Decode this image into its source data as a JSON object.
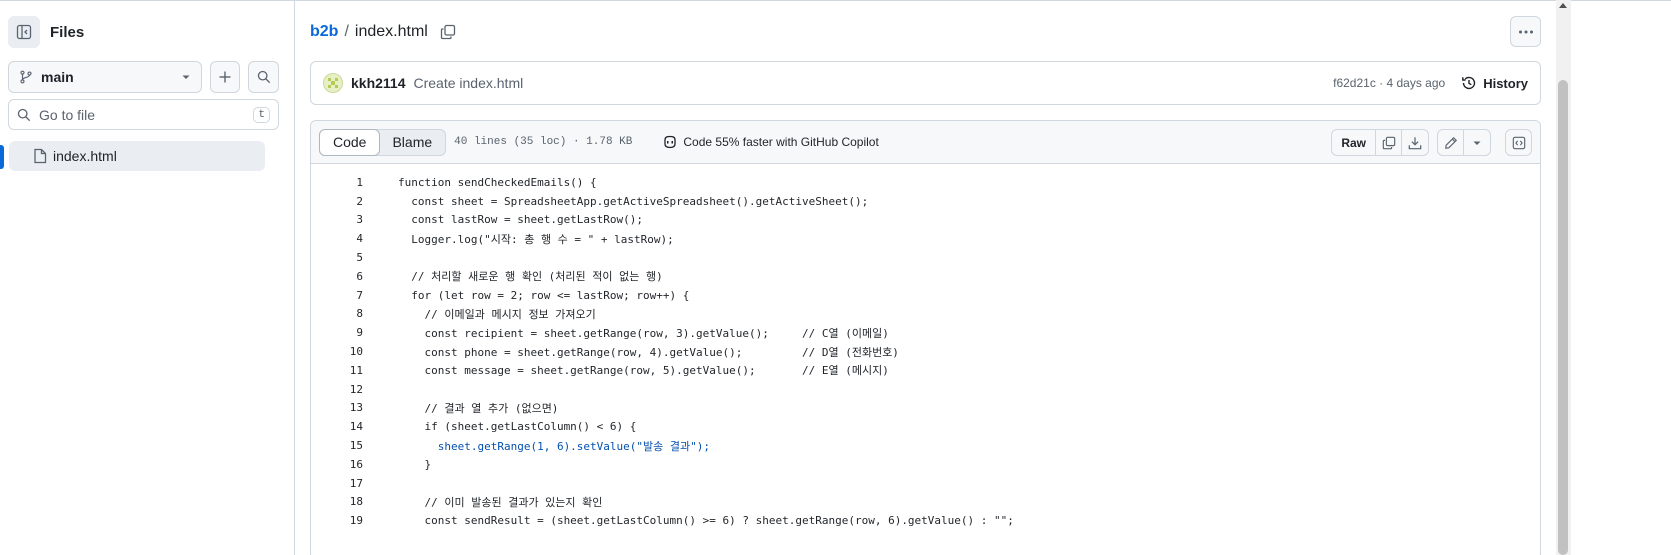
{
  "sidebar": {
    "title": "Files",
    "branch": "main",
    "goto_placeholder": "Go to file",
    "goto_shortcut": "t",
    "tree": [
      {
        "name": "index.html",
        "selected": true
      }
    ]
  },
  "breadcrumb": {
    "repo": "b2b",
    "separator": "/",
    "file": "index.html"
  },
  "commit": {
    "author": "kkh2114",
    "message": "Create index.html",
    "meta": "f62d21c · 4 days ago",
    "history_label": "History"
  },
  "file_header": {
    "tabs": [
      {
        "label": "Code",
        "active": true
      },
      {
        "label": "Blame",
        "active": false
      }
    ],
    "lines_info": "40 lines (35 loc) · 1.78 KB",
    "copilot_text": "Code 55% faster with GitHub Copilot",
    "raw_label": "Raw"
  },
  "code_lines": [
    {
      "n": "1",
      "text": "function sendCheckedEmails() {"
    },
    {
      "n": "2",
      "text": "  const sheet = SpreadsheetApp.getActiveSpreadsheet().getActiveSheet();"
    },
    {
      "n": "3",
      "text": "  const lastRow = sheet.getLastRow();"
    },
    {
      "n": "4",
      "text": "  Logger.log(\"시작: 총 행 수 = \" + lastRow);"
    },
    {
      "n": "5",
      "text": ""
    },
    {
      "n": "6",
      "text": "  // 처리할 새로운 행 확인 (처리된 적이 없는 행)"
    },
    {
      "n": "7",
      "text": "  for (let row = 2; row <= lastRow; row++) {"
    },
    {
      "n": "8",
      "text": "    // 이메일과 메시지 정보 가져오기"
    },
    {
      "n": "9",
      "text": "    const recipient = sheet.getRange(row, 3).getValue();     // C열 (이메일)"
    },
    {
      "n": "10",
      "text": "    const phone = sheet.getRange(row, 4).getValue();         // D열 (전화번호)"
    },
    {
      "n": "11",
      "text": "    const message = sheet.getRange(row, 5).getValue();       // E열 (메시지)"
    },
    {
      "n": "12",
      "text": ""
    },
    {
      "n": "13",
      "text": "    // 결과 열 추가 (없으면)"
    },
    {
      "n": "14",
      "text": "    if (sheet.getLastColumn() < 6) {"
    },
    {
      "n": "15",
      "text": "      sheet.getRange(1, 6).setValue(\"발송 결과\");"
    },
    {
      "n": "16",
      "text": "    }"
    },
    {
      "n": "17",
      "text": ""
    },
    {
      "n": "18",
      "text": "    // 이미 발송된 결과가 있는지 확인"
    },
    {
      "n": "19",
      "text": "    const sendResult = (sheet.getLastColumn() >= 6) ? sheet.getRange(row, 6).getValue() : \"\";"
    }
  ],
  "colors": {
    "accent": "#0969da",
    "border": "#d0d7de",
    "muted": "#59636e",
    "code_blue": "#0550ae"
  },
  "icons": [
    "sidebar-collapse-icon",
    "git-branch-icon",
    "triangle-down-icon",
    "plus-icon",
    "search-icon",
    "file-icon",
    "copy-icon",
    "kebab-icon",
    "history-icon",
    "copilot-icon",
    "download-icon",
    "pencil-icon",
    "symbols-icon"
  ]
}
